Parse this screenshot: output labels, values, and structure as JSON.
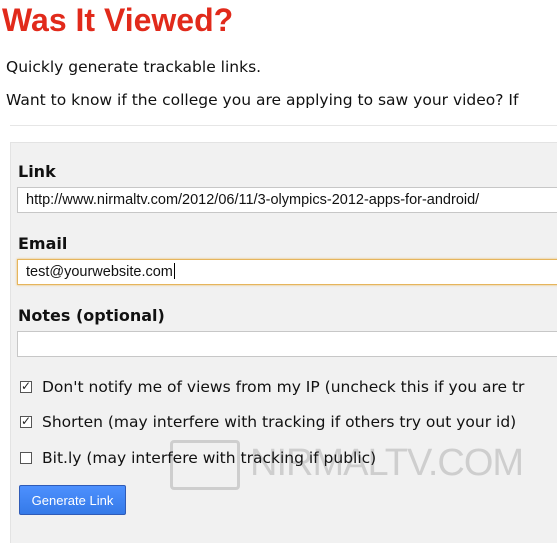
{
  "header": {
    "title": "Was It Viewed?",
    "subtitle": "Quickly generate trackable links.",
    "description": "Want to know if the college you are applying to saw your video? If"
  },
  "form": {
    "link_label": "Link",
    "link_value": "http://www.nirmaltv.com/2012/06/11/3-olympics-2012-apps-for-android/",
    "email_label": "Email",
    "email_value": "test@yourwebsite.com",
    "notes_label": "Notes (optional)",
    "notes_value": "",
    "options": [
      {
        "label": "Don't notify me of views from my IP (uncheck this if you are tr",
        "checked": true
      },
      {
        "label": "Shorten (may interfere with tracking if others try out your id)",
        "checked": true
      },
      {
        "label": "Bit.ly (may interfere with tracking if public)",
        "checked": false
      }
    ],
    "submit_label": "Generate Link"
  },
  "watermark": {
    "text": "NIRMALTV.COM"
  },
  "colors": {
    "title": "#e12a1b",
    "button": "#4d90fe",
    "panel": "#f1f1f1"
  }
}
